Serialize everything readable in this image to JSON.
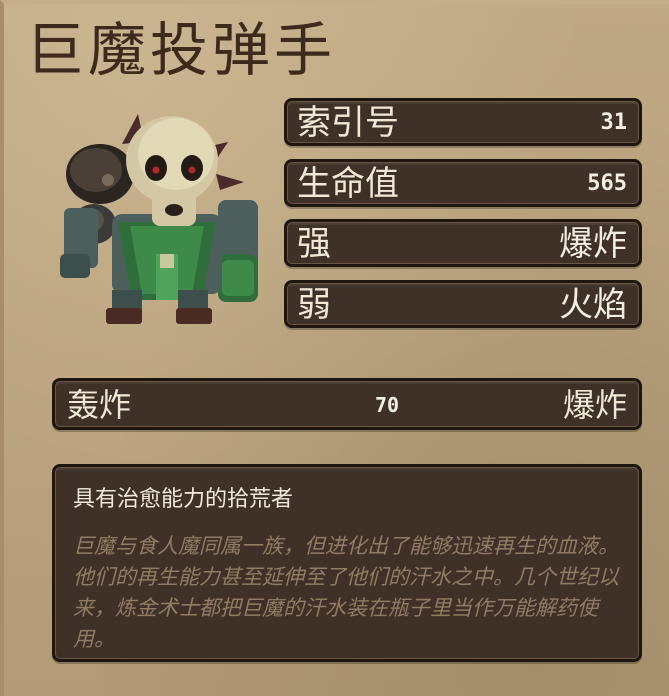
{
  "monster": {
    "name": "巨魔投弹手",
    "sprite_icon": "troll-bombardier-sprite"
  },
  "stats": [
    {
      "label": "索引号",
      "value": "31"
    },
    {
      "label": "生命值",
      "value": "565"
    },
    {
      "label": "强",
      "value": "爆炸"
    },
    {
      "label": "弱",
      "value": "火焰"
    }
  ],
  "attack": {
    "name": "轰炸",
    "damage": "70",
    "element": "爆炸"
  },
  "description": {
    "title": "具有治愈能力的拾荒者",
    "body": "巨魔与食人魔同属一族，但进化出了能够迅速再生的血液。他们的再生能力甚至延伸至了他们的汗水之中。几个世纪以来，炼金术士都把巨魔的汗水装在瓶子里当作万能解药使用。"
  },
  "colors": {
    "parchment": "#b8a17c",
    "panel": "#3f3127",
    "panel_border": "#1f1610",
    "title_text": "#3d2a1c",
    "muted_text": "#8f7c63"
  }
}
